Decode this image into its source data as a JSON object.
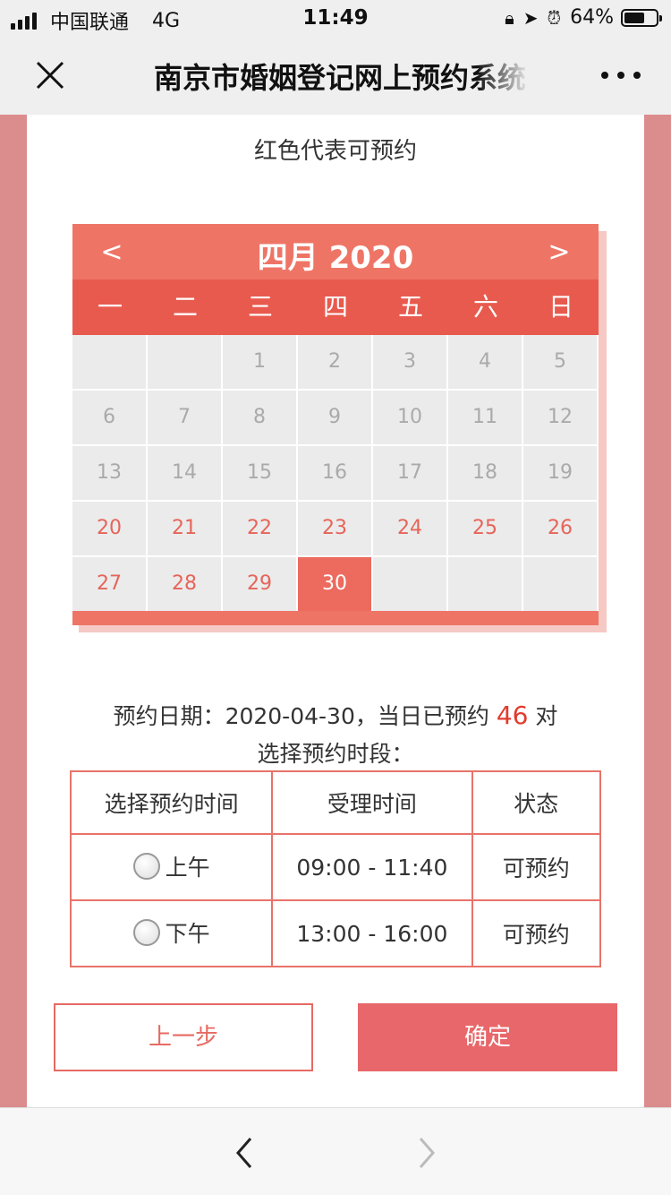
{
  "status_bar": {
    "carrier": "中国联通",
    "network": "4G",
    "time": "11:49",
    "battery": "64%",
    "battery_level": 0.64
  },
  "nav": {
    "title": "南京市婚姻登记网上预约系统"
  },
  "page": {
    "hint": "红色代表可预约"
  },
  "calendar": {
    "prev_label": "<",
    "next_label": ">",
    "title": "四月 2020",
    "weekdays": [
      "一",
      "二",
      "三",
      "四",
      "五",
      "六",
      "日"
    ],
    "days": [
      {
        "label": "",
        "state": "empty"
      },
      {
        "label": "",
        "state": "empty"
      },
      {
        "label": "1",
        "state": "disabled"
      },
      {
        "label": "2",
        "state": "disabled"
      },
      {
        "label": "3",
        "state": "disabled"
      },
      {
        "label": "4",
        "state": "disabled"
      },
      {
        "label": "5",
        "state": "disabled"
      },
      {
        "label": "6",
        "state": "disabled"
      },
      {
        "label": "7",
        "state": "disabled"
      },
      {
        "label": "8",
        "state": "disabled"
      },
      {
        "label": "9",
        "state": "disabled"
      },
      {
        "label": "10",
        "state": "disabled"
      },
      {
        "label": "11",
        "state": "disabled"
      },
      {
        "label": "12",
        "state": "disabled"
      },
      {
        "label": "13",
        "state": "disabled"
      },
      {
        "label": "14",
        "state": "disabled"
      },
      {
        "label": "15",
        "state": "disabled"
      },
      {
        "label": "16",
        "state": "disabled"
      },
      {
        "label": "17",
        "state": "disabled"
      },
      {
        "label": "18",
        "state": "disabled"
      },
      {
        "label": "19",
        "state": "disabled"
      },
      {
        "label": "20",
        "state": "available"
      },
      {
        "label": "21",
        "state": "available"
      },
      {
        "label": "22",
        "state": "available"
      },
      {
        "label": "23",
        "state": "available"
      },
      {
        "label": "24",
        "state": "available"
      },
      {
        "label": "25",
        "state": "available"
      },
      {
        "label": "26",
        "state": "available"
      },
      {
        "label": "27",
        "state": "available"
      },
      {
        "label": "28",
        "state": "available"
      },
      {
        "label": "29",
        "state": "available"
      },
      {
        "label": "30",
        "state": "selected"
      },
      {
        "label": "",
        "state": "empty"
      },
      {
        "label": "",
        "state": "empty"
      },
      {
        "label": "",
        "state": "empty"
      }
    ]
  },
  "booking": {
    "date_prefix": "预约日期：2020-04-30，当日已预约",
    "count": "46",
    "unit": "对",
    "slot_label": "选择预约时段："
  },
  "slots_table": {
    "headers": [
      "选择预约时间",
      "受理时间",
      "状态"
    ],
    "rows": [
      {
        "name": "上午",
        "time": "09:00 - 11:40",
        "status": "可预约"
      },
      {
        "name": "下午",
        "time": "13:00 - 16:00",
        "status": "可预约"
      }
    ]
  },
  "actions": {
    "prev_label": "上一步",
    "confirm_label": "确定"
  },
  "colors": {
    "accent": "#e8676a",
    "calendar_header": "#ee7566",
    "weekday_bar": "#e85a4e",
    "available_text": "#e6655a",
    "count_text": "#e23b2e"
  }
}
